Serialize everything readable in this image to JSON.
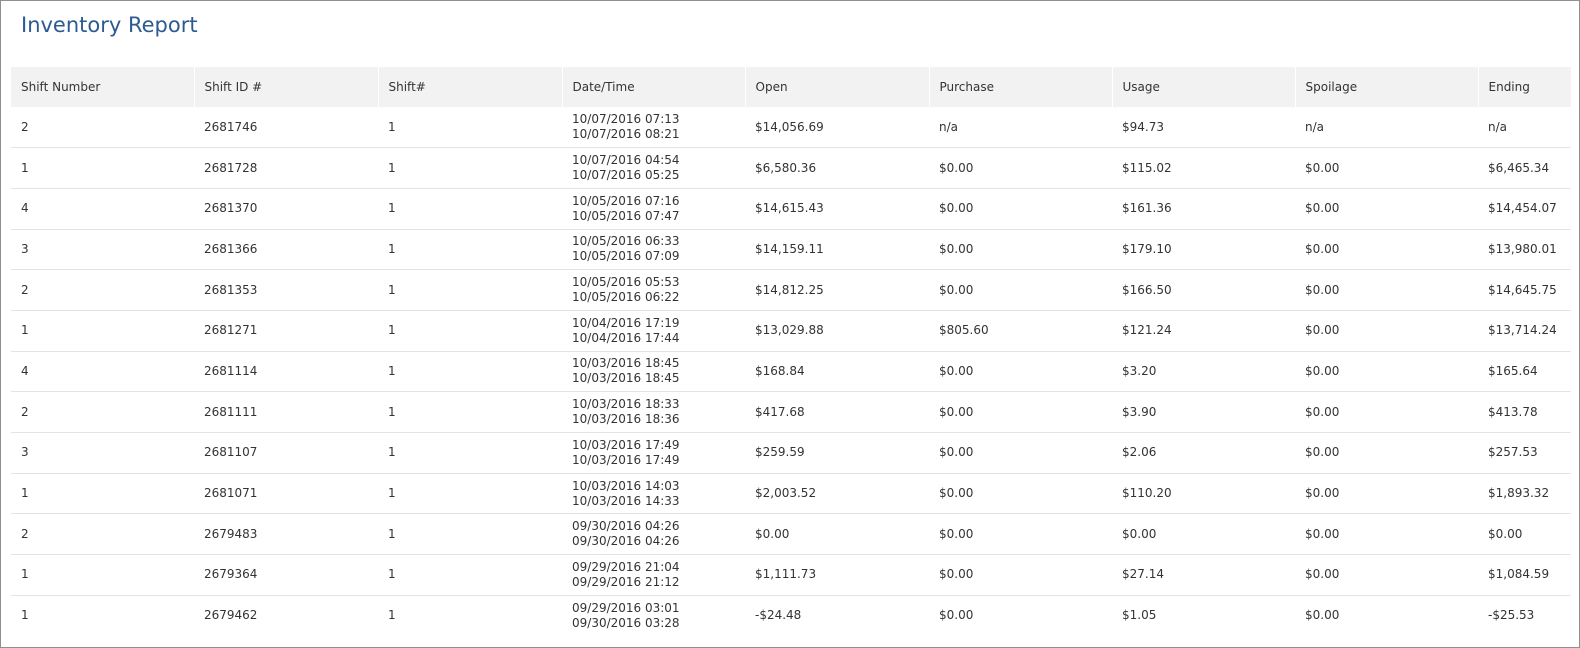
{
  "report": {
    "title": "Inventory Report"
  },
  "columns": [
    "Shift Number",
    "Shift ID #",
    "Shift#",
    "Date/Time",
    "Open",
    "Purchase",
    "Usage",
    "Spoilage",
    "Ending"
  ],
  "rows": [
    {
      "shift_number": "2",
      "shift_id": "2681746",
      "shift": "1",
      "start": "10/07/2016 07:13",
      "end": "10/07/2016 08:21",
      "open": "$14,056.69",
      "purchase": "n/a",
      "usage": "$94.73",
      "spoilage": "n/a",
      "ending": "n/a"
    },
    {
      "shift_number": "1",
      "shift_id": "2681728",
      "shift": "1",
      "start": "10/07/2016 04:54",
      "end": "10/07/2016 05:25",
      "open": "$6,580.36",
      "purchase": "$0.00",
      "usage": "$115.02",
      "spoilage": "$0.00",
      "ending": "$6,465.34"
    },
    {
      "shift_number": "4",
      "shift_id": "2681370",
      "shift": "1",
      "start": "10/05/2016 07:16",
      "end": "10/05/2016 07:47",
      "open": "$14,615.43",
      "purchase": "$0.00",
      "usage": "$161.36",
      "spoilage": "$0.00",
      "ending": "$14,454.07"
    },
    {
      "shift_number": "3",
      "shift_id": "2681366",
      "shift": "1",
      "start": "10/05/2016 06:33",
      "end": "10/05/2016 07:09",
      "open": "$14,159.11",
      "purchase": "$0.00",
      "usage": "$179.10",
      "spoilage": "$0.00",
      "ending": "$13,980.01"
    },
    {
      "shift_number": "2",
      "shift_id": "2681353",
      "shift": "1",
      "start": "10/05/2016 05:53",
      "end": "10/05/2016 06:22",
      "open": "$14,812.25",
      "purchase": "$0.00",
      "usage": "$166.50",
      "spoilage": "$0.00",
      "ending": "$14,645.75"
    },
    {
      "shift_number": "1",
      "shift_id": "2681271",
      "shift": "1",
      "start": "10/04/2016 17:19",
      "end": "10/04/2016 17:44",
      "open": "$13,029.88",
      "purchase": "$805.60",
      "usage": "$121.24",
      "spoilage": "$0.00",
      "ending": "$13,714.24"
    },
    {
      "shift_number": "4",
      "shift_id": "2681114",
      "shift": "1",
      "start": "10/03/2016 18:45",
      "end": "10/03/2016 18:45",
      "open": "$168.84",
      "purchase": "$0.00",
      "usage": "$3.20",
      "spoilage": "$0.00",
      "ending": "$165.64"
    },
    {
      "shift_number": "2",
      "shift_id": "2681111",
      "shift": "1",
      "start": "10/03/2016 18:33",
      "end": "10/03/2016 18:36",
      "open": "$417.68",
      "purchase": "$0.00",
      "usage": "$3.90",
      "spoilage": "$0.00",
      "ending": "$413.78"
    },
    {
      "shift_number": "3",
      "shift_id": "2681107",
      "shift": "1",
      "start": "10/03/2016 17:49",
      "end": "10/03/2016 17:49",
      "open": "$259.59",
      "purchase": "$0.00",
      "usage": "$2.06",
      "spoilage": "$0.00",
      "ending": "$257.53"
    },
    {
      "shift_number": "1",
      "shift_id": "2681071",
      "shift": "1",
      "start": "10/03/2016 14:03",
      "end": "10/03/2016 14:33",
      "open": "$2,003.52",
      "purchase": "$0.00",
      "usage": "$110.20",
      "spoilage": "$0.00",
      "ending": "$1,893.32"
    },
    {
      "shift_number": "2",
      "shift_id": "2679483",
      "shift": "1",
      "start": "09/30/2016 04:26",
      "end": "09/30/2016 04:26",
      "open": "$0.00",
      "purchase": "$0.00",
      "usage": "$0.00",
      "spoilage": "$0.00",
      "ending": "$0.00"
    },
    {
      "shift_number": "1",
      "shift_id": "2679364",
      "shift": "1",
      "start": "09/29/2016 21:04",
      "end": "09/29/2016 21:12",
      "open": "$1,111.73",
      "purchase": "$0.00",
      "usage": "$27.14",
      "spoilage": "$0.00",
      "ending": "$1,084.59"
    },
    {
      "shift_number": "1",
      "shift_id": "2679462",
      "shift": "1",
      "start": "09/29/2016 03:01",
      "end": "09/30/2016 03:28",
      "open": "-$24.48",
      "purchase": "$0.00",
      "usage": "$1.05",
      "spoilage": "$0.00",
      "ending": "-$25.53"
    }
  ]
}
